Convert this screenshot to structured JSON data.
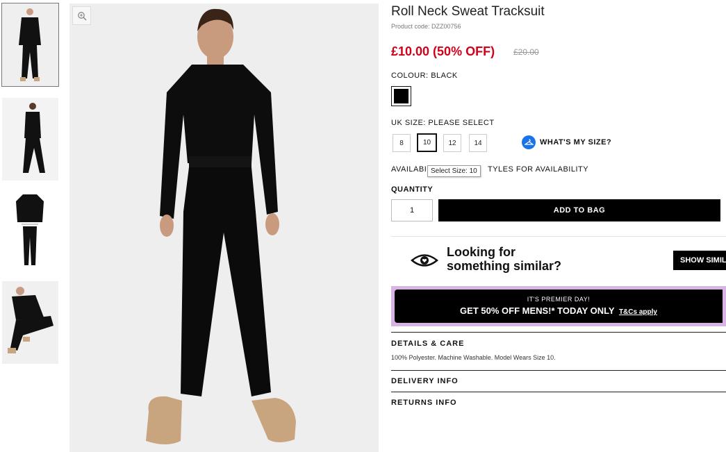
{
  "product": {
    "title": "Roll Neck Sweat Tracksuit",
    "code": "Product code: DZZ00756",
    "price": "£10.00 (50% OFF)",
    "old_price": "£20.00"
  },
  "colour": {
    "label": "COLOUR:",
    "value": "BLACK",
    "swatch_color": "#000000"
  },
  "size": {
    "label": "UK SIZE:",
    "value": "PLEASE SELECT",
    "options": [
      "8",
      "10",
      "12",
      "14"
    ],
    "selected": "10",
    "whats_my_size": "WHAT'S MY SIZE?",
    "tooltip": "Select Size: 10"
  },
  "availability": {
    "left": "AVAILABI",
    "right": "TYLES FOR AVAILABILITY"
  },
  "quantity": {
    "label": "QUANTITY",
    "value": "1"
  },
  "add_to_bag": "ADD TO BAG",
  "similar": {
    "line1": "Looking for",
    "line2": "something similar?",
    "button": "SHOW SIMILAR"
  },
  "promo": {
    "top": "IT'S PREMIER DAY!",
    "main": "GET 50% OFF MENS!* TODAY ONLY",
    "link": "T&Cs apply",
    "bg_color": "#d9b3e6"
  },
  "sections": {
    "details_title": "DETAILS & CARE",
    "details_body": "100% Polyester. Machine Washable. Model Wears Size 10.",
    "delivery_title": "DELIVERY INFO",
    "returns_title": "RETURNS INFO"
  },
  "icons": {
    "zoom": "zoom-in-icon",
    "hanger": "hanger-icon",
    "eye": "eye-heart-icon"
  }
}
